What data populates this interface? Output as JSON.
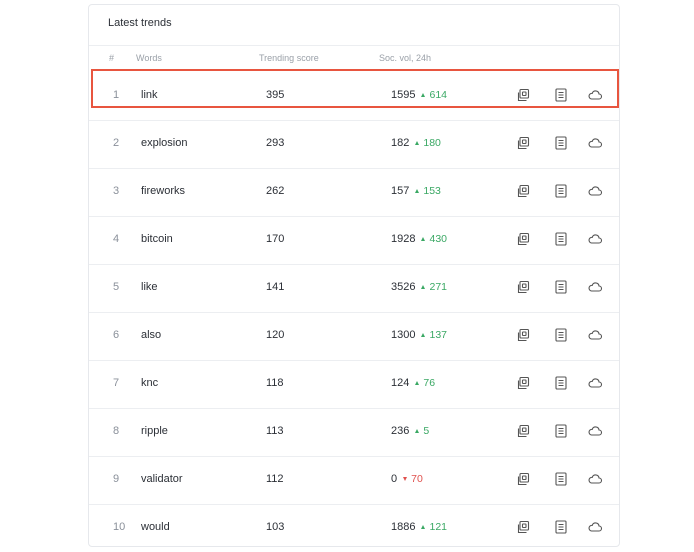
{
  "card": {
    "title": "Latest trends"
  },
  "columns": {
    "rank": "#",
    "words": "Words",
    "score": "Trending score",
    "social": "Soc. vol, 24h"
  },
  "colors": {
    "positive": "#3aa864",
    "negative": "#e0514e",
    "highlight": "#e8553f"
  },
  "icons": [
    "compare-icon",
    "details-icon",
    "word-cloud-icon"
  ],
  "rows": [
    {
      "rank": "1",
      "word": "link",
      "score": "395",
      "soc_vol": "1595",
      "change": "614",
      "direction": "up",
      "highlighted": true
    },
    {
      "rank": "2",
      "word": "explosion",
      "score": "293",
      "soc_vol": "182",
      "change": "180",
      "direction": "up"
    },
    {
      "rank": "3",
      "word": "fireworks",
      "score": "262",
      "soc_vol": "157",
      "change": "153",
      "direction": "up"
    },
    {
      "rank": "4",
      "word": "bitcoin",
      "score": "170",
      "soc_vol": "1928",
      "change": "430",
      "direction": "up"
    },
    {
      "rank": "5",
      "word": "like",
      "score": "141",
      "soc_vol": "3526",
      "change": "271",
      "direction": "up"
    },
    {
      "rank": "6",
      "word": "also",
      "score": "120",
      "soc_vol": "1300",
      "change": "137",
      "direction": "up"
    },
    {
      "rank": "7",
      "word": "knc",
      "score": "118",
      "soc_vol": "124",
      "change": "76",
      "direction": "up"
    },
    {
      "rank": "8",
      "word": "ripple",
      "score": "113",
      "soc_vol": "236",
      "change": "5",
      "direction": "up"
    },
    {
      "rank": "9",
      "word": "validator",
      "score": "112",
      "soc_vol": "0",
      "change": "70",
      "direction": "down"
    },
    {
      "rank": "10",
      "word": "would",
      "score": "103",
      "soc_vol": "1886",
      "change": "121",
      "direction": "up"
    }
  ]
}
